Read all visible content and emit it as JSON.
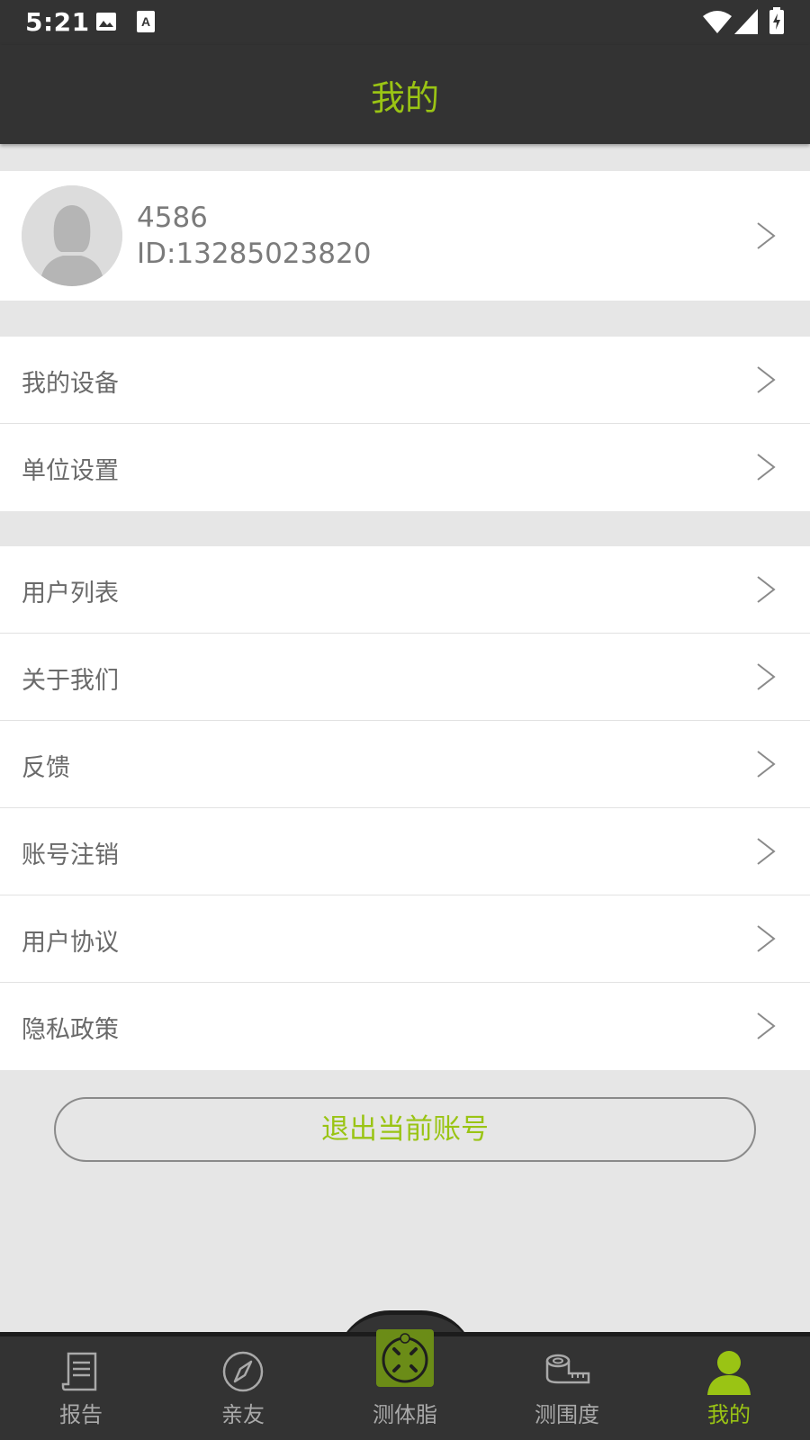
{
  "status_bar": {
    "time": "5:21",
    "icons": [
      "image-icon",
      "a-icon",
      "wifi-icon",
      "signal-icon",
      "battery-icon"
    ]
  },
  "header": {
    "title": "我的"
  },
  "profile": {
    "name": "4586",
    "id": "ID:13285023820"
  },
  "settings_group_1": [
    {
      "label": "我的设备"
    },
    {
      "label": "单位设置"
    }
  ],
  "settings_group_2": [
    {
      "label": "用户列表"
    },
    {
      "label": "关于我们"
    },
    {
      "label": "反馈"
    },
    {
      "label": "账号注销"
    },
    {
      "label": "用户协议"
    },
    {
      "label": "隐私政策"
    }
  ],
  "logout": {
    "label": "退出当前账号"
  },
  "tabbar": {
    "items": [
      {
        "label": "报告",
        "icon": "report-icon"
      },
      {
        "label": "亲友",
        "icon": "compass-icon"
      },
      {
        "label": "测体脂",
        "icon": "scale-icon"
      },
      {
        "label": "测围度",
        "icon": "tape-measure-icon"
      },
      {
        "label": "我的",
        "icon": "person-icon",
        "active": true
      }
    ]
  },
  "colors": {
    "accent": "#9ac414",
    "bar_bg": "#333333",
    "page_bg": "#e6e6e6"
  }
}
